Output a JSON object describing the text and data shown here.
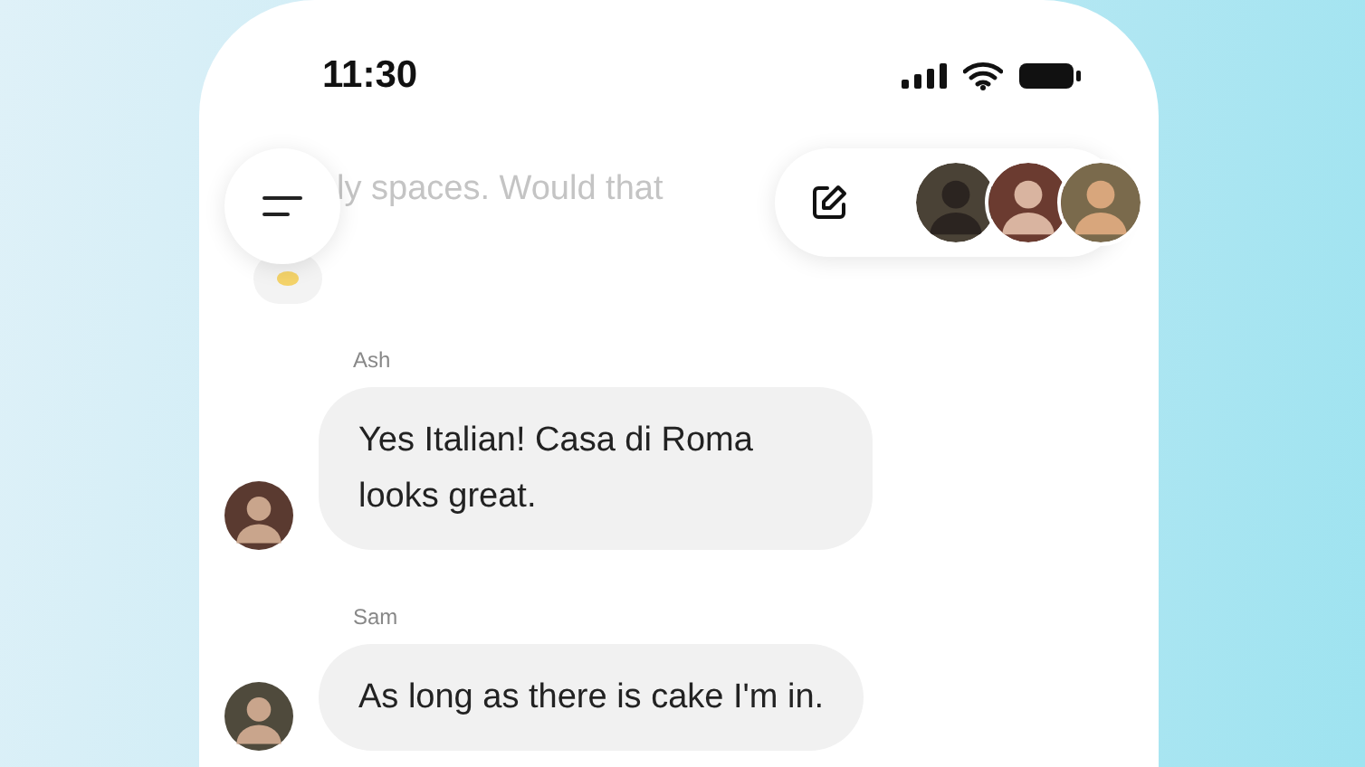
{
  "status_bar": {
    "time": "11:30"
  },
  "faded_message": {
    "text": "ly spaces. Would that"
  },
  "messages": [
    {
      "sender": "Ash",
      "text": "Yes Italian! Casa di Roma looks great."
    },
    {
      "sender": "Sam",
      "text": "As long as there is cake I'm in."
    }
  ]
}
